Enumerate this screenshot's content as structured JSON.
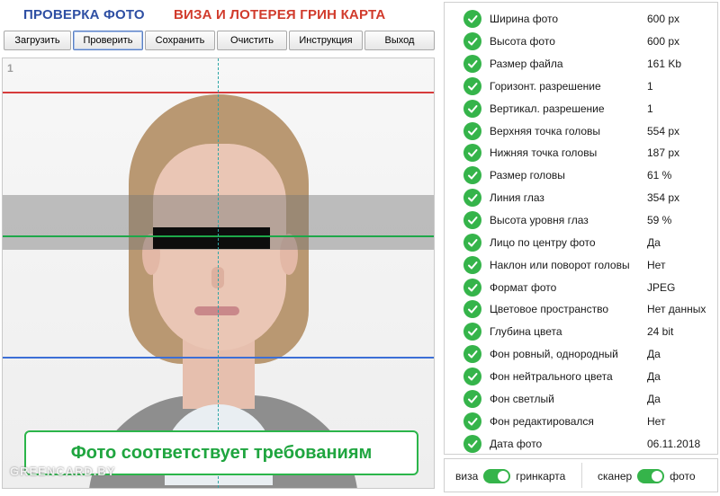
{
  "header": {
    "title_left": "ПРОВЕРКА ФОТО",
    "title_right": "ВИЗА И ЛОТЕРЕЯ ГРИН КАРТА"
  },
  "toolbar": {
    "buttons": [
      "Загрузить",
      "Проверить",
      "Сохранить",
      "Очистить",
      "Инструкция",
      "Выход"
    ]
  },
  "photo": {
    "number": "1",
    "watermark": "GREENCARD.BY",
    "verdict": "Фото соответствует требованиям"
  },
  "results": [
    {
      "label": "Ширина фото",
      "value": "600 px"
    },
    {
      "label": "Высота фото",
      "value": "600 px"
    },
    {
      "label": "Размер файла",
      "value": "161 Kb"
    },
    {
      "label": "Горизонт. разрешение",
      "value": "1"
    },
    {
      "label": "Вертикал. разрешение",
      "value": "1"
    },
    {
      "label": "Верхняя точка головы",
      "value": "554 px"
    },
    {
      "label": "Нижняя точка головы",
      "value": "187 px"
    },
    {
      "label": "Размер головы",
      "value": "61 %"
    },
    {
      "label": "Линия глаз",
      "value": "354 px"
    },
    {
      "label": "Высота уровня глаз",
      "value": "59 %"
    },
    {
      "label": "Лицо по центру фото",
      "value": "Да"
    },
    {
      "label": "Наклон или поворот головы",
      "value": "Нет"
    },
    {
      "label": "Формат фото",
      "value": "JPEG"
    },
    {
      "label": "Цветовое пространство",
      "value": "Нет данных"
    },
    {
      "label": "Глубина цвета",
      "value": "24 bit"
    },
    {
      "label": "Фон ровный, однородный",
      "value": "Да"
    },
    {
      "label": "Фон нейтрального цвета",
      "value": "Да"
    },
    {
      "label": "Фон светлый",
      "value": "Да"
    },
    {
      "label": "Фон редактировался",
      "value": "Нет"
    },
    {
      "label": "Дата фото",
      "value": "06.11.2018"
    }
  ],
  "toggles": {
    "left": {
      "off_label": "виза",
      "on_label": "гринкарта",
      "state": "on"
    },
    "right": {
      "off_label": "сканер",
      "on_label": "фото",
      "state": "on"
    }
  },
  "colors": {
    "title_left": "#2e4fa3",
    "title_right": "#d13b2c",
    "check": "#35b44a",
    "verdict": "#1fa53f"
  }
}
